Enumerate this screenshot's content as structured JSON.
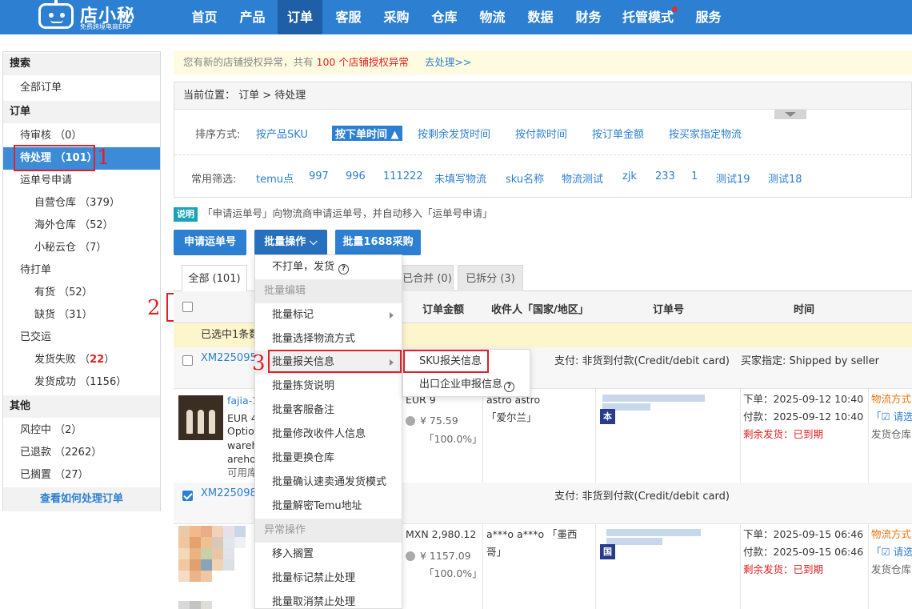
{
  "brand": {
    "name": "店小秘",
    "subtitle": "免费跨境电商ERP"
  },
  "nav": [
    "首页",
    "产品",
    "订单",
    "客服",
    "采购",
    "仓库",
    "物流",
    "数据",
    "财务",
    "托管模式",
    "服务"
  ],
  "nav_active": "订单",
  "sidebar": {
    "search_head": "搜索",
    "all_orders": "全部订单",
    "orders_head": "订单",
    "pending_review": "待审核 （0）",
    "pending_process": "待处理 （101）",
    "waybill_apply": "运单号申请",
    "own_warehouse": "自营仓库 （379）",
    "overseas_warehouse": "海外仓库 （52）",
    "xiaomi_cloud": "小秘云仓 （7）",
    "to_print": "待打单",
    "in_stock": "有货 （52）",
    "out_of_stock": "缺货 （31）",
    "shipped": "已交运",
    "ship_failed_label": "发货失败 （",
    "ship_failed_count": "22",
    "ship_failed_close": "）",
    "ship_success": "发货成功 （1156）",
    "other_head": "其他",
    "risk": "风控中 （2）",
    "refunded": "已退款 （2262）",
    "shelved": "已搁置 （27）",
    "help_link": "查看如何处理订单"
  },
  "annotations": [
    "1",
    "2",
    "3"
  ],
  "notice": {
    "prefix": "您有新的店铺授权异常，共有",
    "count": "100 个店铺授权异常",
    "action": "去处理>>"
  },
  "breadcrumb": "当前位置： 订单 > 待处理",
  "sort": {
    "label": "排序方式:",
    "options": [
      "按产品SKU",
      "按下单时间 ▲",
      "按剩余发货时间",
      "按付款时间",
      "按订单金额",
      "按买家指定物流"
    ]
  },
  "filters": {
    "label": "常用筛选:",
    "options": [
      "temu点",
      "997",
      "996",
      "111222",
      "未填写物流",
      "sku名称",
      "物流测试",
      "zjk",
      "233",
      "1",
      "测试19",
      "测试18"
    ]
  },
  "explain": {
    "tag": "说明",
    "text": "「申请运单号」向物流商申请运单号，并自动移入「运单号申请」"
  },
  "buttons": {
    "apply_waybill": "申请运单号",
    "batch_ops": "批量操作 ⌵",
    "batch_1688": "批量1688采购"
  },
  "tabs": [
    "全部 (101)",
    "已合并 (0)",
    "已拆分 (3)"
  ],
  "table_headers": {
    "amount": "订单金额",
    "recipient": "收件人「国家/地区」",
    "order_no": "订单号",
    "time": "时间"
  },
  "selected_bar": "已选中1条数",
  "orders": [
    {
      "order_no": "XM22509584",
      "pay": "支付: 非货到付款(Credit/debit card)",
      "buyer": "买家指定:  Shipped by seller",
      "product_lines": [
        "fajia-1",
        "EUR 4",
        "Option",
        "wareh",
        "areho",
        "可用库"
      ],
      "amount": "EUR 9",
      "rmb": "¥ 75.59",
      "pct": "「100.0%」",
      "recipient_name": "astro astro",
      "recipient_country": "「爱尔兰」",
      "flag": "本",
      "order_time": "下单：2025-09-12 10:40",
      "pay_time": "付款：2025-09-12 10:40",
      "remain": "剩余发货：已到期",
      "logistics": "物流方式",
      "apply": "「☑ 请选",
      "warehouse": "发货仓库"
    },
    {
      "order_no": "XM22509884",
      "pay": "支付: 非货到付款(Credit/debit card)",
      "amount": "MXN 2,980.12",
      "rmb": "¥ 1157.09",
      "pct": "「100.0%」",
      "recipient_name": "a***o a***o",
      "recipient_country_a": "「墨西",
      "recipient_country_b": "哥」",
      "flag": "国",
      "order_time": "下单：2025-09-15 06:46",
      "pay_time": "付款：2025-09-15 06:46",
      "remain": "剩余发货：已到期",
      "logistics": "物流方式",
      "apply": "「☑ 请选",
      "warehouse": "发货仓库"
    }
  ],
  "dropdown": {
    "no_print_ship": "不打单，发货",
    "group_edit": "批量编辑",
    "batch_mark": "批量标记",
    "batch_logistics": "批量选择物流方式",
    "batch_customs": "批量报关信息",
    "batch_pick_note": "批量拣货说明",
    "batch_cs_note": "批量客服备注",
    "batch_edit_recipient": "批量修改收件人信息",
    "batch_change_wh": "批量更换仓库",
    "batch_confirm_express": "批量确认速卖通发货模式",
    "batch_decrypt_temu": "批量解密Temu地址",
    "group_exception": "异常操作",
    "move_shelved": "移入搁置",
    "batch_mark_forbid": "批量标记禁止处理",
    "batch_cancel_forbid": "批量取消禁止处理"
  },
  "submenu": {
    "sku_customs": "SKU报关信息",
    "export_declare": "出口企业申报信息"
  },
  "colors": {
    "nav_bg": "#2d7fd1",
    "nav_active": "#1e5fa8",
    "accent": "#2d7fd1",
    "annotation": "#e0202a",
    "selected_bar": "#fdf6cc"
  }
}
